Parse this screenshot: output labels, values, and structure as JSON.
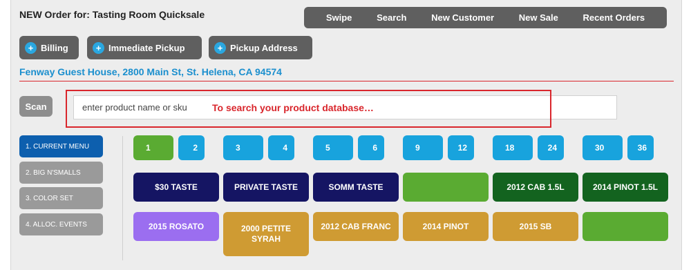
{
  "title": "NEW Order for: Tasting Room Quicksale",
  "topnav": [
    "Swipe",
    "Search",
    "New Customer",
    "New Sale",
    "Recent Orders"
  ],
  "actions": {
    "billing": "Billing",
    "pickup": "Immediate Pickup",
    "address": "Pickup Address",
    "plus_glyph": "+"
  },
  "address": "Fenway Guest House, 2800 Main St, St. Helena, CA 94574",
  "scan_label": "Scan",
  "search": {
    "placeholder": "enter product name or sku",
    "hint": "To search your product database…"
  },
  "menu": [
    "1. CURRENT MENU",
    "2. BIG N'SMALLS",
    "3. COLOR SET",
    "4. ALLOC. EVENTS"
  ],
  "quantities": [
    "1",
    "2",
    "3",
    "4",
    "5",
    "6",
    "9",
    "12",
    "18",
    "24",
    "30",
    "36"
  ],
  "products": [
    {
      "label": "$30 TASTE",
      "color": "#151563"
    },
    {
      "label": "PRIVATE TASTE",
      "color": "#151563"
    },
    {
      "label": "SOMM TASTE",
      "color": "#151563"
    },
    {
      "label": "",
      "color": "#5aab32"
    },
    {
      "label": "2012 CAB 1.5L",
      "color": "#13631f"
    },
    {
      "label": "2014 PINOT 1.5L",
      "color": "#13631f"
    },
    {
      "label": "2015 ROSATO",
      "color": "#9b6ef0"
    },
    {
      "label": "2000 PETITE SYRAH",
      "color": "#cf9b33"
    },
    {
      "label": "2012 CAB FRANC",
      "color": "#cf9b33"
    },
    {
      "label": "2014 PINOT",
      "color": "#cf9b33"
    },
    {
      "label": "2015 SB",
      "color": "#cf9b33"
    },
    {
      "label": "",
      "color": "#5aab32"
    }
  ],
  "colors": {
    "accent_blue": "#1b8fce",
    "quantity_blue": "#18a3dd",
    "quantity_green": "#5aab32",
    "alert_red": "#d9262c",
    "menu_active": "#0d5fae"
  }
}
